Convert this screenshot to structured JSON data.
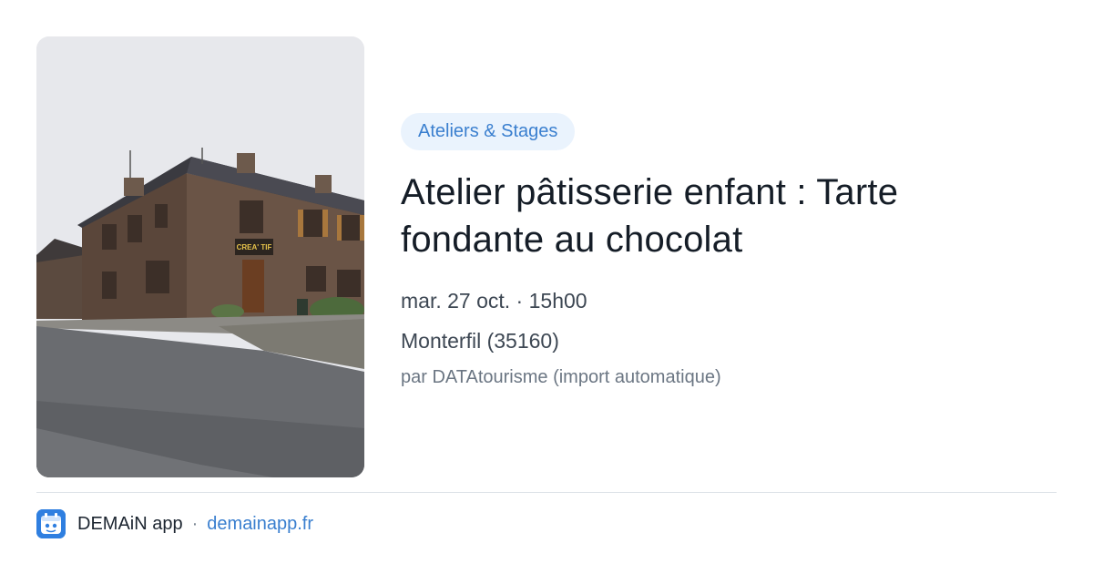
{
  "event": {
    "category": "Ateliers & Stages",
    "title": "Atelier pâtisserie enfant : Tarte fondante au chocolat",
    "datetime": "mar. 27 oct. · 15h00",
    "location": "Monterfil (35160)",
    "source": "par DATAtourisme (import automatique)",
    "photo_sign": "CREA' TIF"
  },
  "footer": {
    "app_name": "DEMAiN app",
    "separator": "·",
    "url": "demainapp.fr"
  },
  "colors": {
    "accent": "#3a7fcf",
    "badge_bg": "#eaf3fd",
    "app_icon": "#2f7fe0"
  }
}
